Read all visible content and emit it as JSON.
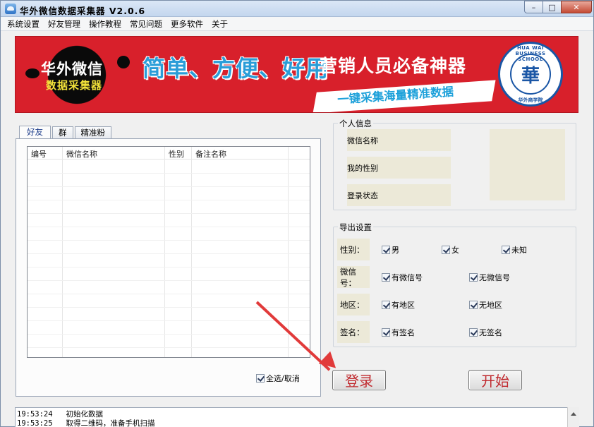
{
  "window": {
    "title": "华外微信数据采集器   V2.0.6"
  },
  "menu": [
    "系统设置",
    "好友管理",
    "操作教程",
    "常见问题",
    "更多软件",
    "关于"
  ],
  "banner": {
    "logo_line1": "华外微信",
    "logo_line2": "数据采集器",
    "slogan": "简单、方便、好用",
    "slogan2": "营销人员必备神器",
    "ribbon": "一键采集海量精准数据",
    "seal_top": "HUA WAI BUSINESS SCHOOL",
    "seal_center": "華",
    "seal_bottom": "华外商学院"
  },
  "tabs": [
    "好友",
    "群",
    "精准粉"
  ],
  "table": {
    "columns": [
      "编号",
      "微信名称",
      "性别",
      "备注名称"
    ],
    "rows": []
  },
  "select_all": {
    "label": "全选/取消",
    "checked": true
  },
  "personal_info": {
    "legend": "个人信息",
    "fields": [
      "微信名称",
      "我的性别",
      "登录状态"
    ]
  },
  "export_settings": {
    "legend": "导出设置",
    "rows": [
      {
        "label": "性别：",
        "options": [
          {
            "label": "男",
            "checked": true
          },
          {
            "label": "女",
            "checked": true
          },
          {
            "label": "未知",
            "checked": true
          }
        ]
      },
      {
        "label": "微信号：",
        "options": [
          {
            "label": "有微信号",
            "checked": true
          },
          {
            "label": "无微信号",
            "checked": true
          }
        ]
      },
      {
        "label": "地区：",
        "options": [
          {
            "label": "有地区",
            "checked": true
          },
          {
            "label": "无地区",
            "checked": true
          }
        ]
      },
      {
        "label": "签名：",
        "options": [
          {
            "label": "有签名",
            "checked": true
          },
          {
            "label": "无签名",
            "checked": true
          }
        ]
      }
    ]
  },
  "buttons": {
    "login": "登录",
    "start": "开始"
  },
  "log": [
    {
      "time": "19:53:24",
      "text": "初始化数据"
    },
    {
      "time": "19:53:25",
      "text": "取得二维码，准备手机扫描"
    }
  ],
  "colors": {
    "banner_red": "#d8202b",
    "button_text": "#c0282d",
    "arrow": "#e13a3a"
  }
}
